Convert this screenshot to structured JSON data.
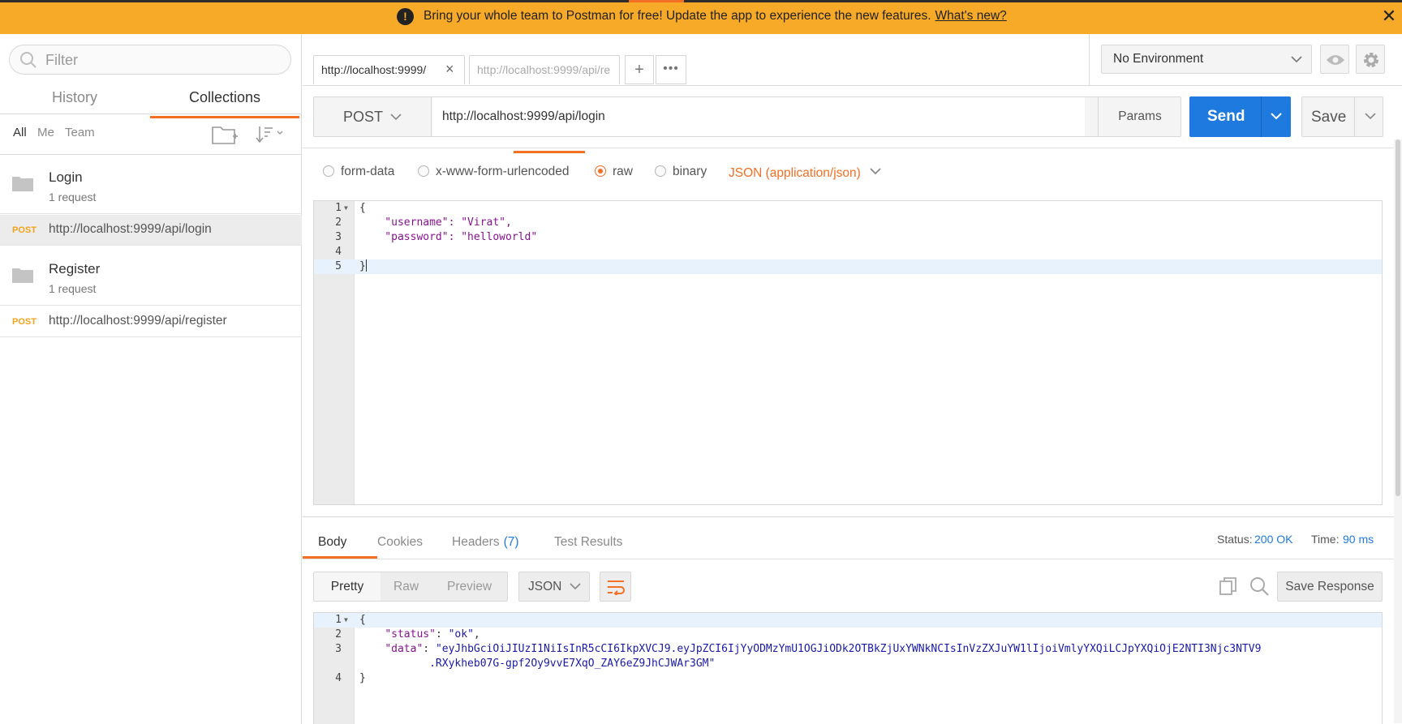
{
  "banner": {
    "message": "Bring your whole team to Postman for free! Update the app to experience the new features.",
    "link": "What's new?",
    "close": "✕",
    "icon": "!"
  },
  "sidebar": {
    "filter_placeholder": "Filter",
    "tabs": [
      "History",
      "Collections"
    ],
    "active_tab": "Collections",
    "filters": [
      "All",
      "Me",
      "Team"
    ],
    "collections": [
      {
        "name": "Login",
        "count": "1 request",
        "request": {
          "method": "POST",
          "url": "http://localhost:9999/api/login"
        }
      },
      {
        "name": "Register",
        "count": "1 request",
        "request": {
          "method": "POST",
          "url": "http://localhost:9999/api/register"
        }
      }
    ]
  },
  "tabs": {
    "items": [
      "http://localhost:9999/",
      "http://localhost:9999/api/re"
    ],
    "close": "×",
    "plus": "+",
    "more": "•••"
  },
  "environment": {
    "selected": "No Environment"
  },
  "request": {
    "method": "POST",
    "url": "http://localhost:9999/api/login",
    "params_label": "Params",
    "send_label": "Send",
    "save_label": "Save",
    "body_modes": [
      "form-data",
      "x-www-form-urlencoded",
      "raw",
      "binary"
    ],
    "selected_mode": "raw",
    "content_type": "JSON (application/json)",
    "body_lines": [
      "{",
      "    \"username\": \"Virat\",",
      "    \"password\": \"helloworld\"",
      "",
      "}"
    ],
    "line_numbers": [
      "1",
      "2",
      "3",
      "4",
      "5"
    ]
  },
  "response": {
    "tabs": [
      "Body",
      "Cookies",
      "Headers",
      "Test Results"
    ],
    "headers_count": "(7)",
    "status_label": "Status:",
    "status": "200 OK",
    "time_label": "Time:",
    "time": "90 ms",
    "view_modes": [
      "Pretty",
      "Raw",
      "Preview"
    ],
    "format": "JSON",
    "save_response_label": "Save Response",
    "line_numbers": [
      "1",
      "2",
      "3",
      "4"
    ],
    "body": {
      "l1": "{",
      "status_key": "\"status\"",
      "status_val": "\"ok\"",
      "data_key": "\"data\"",
      "data_val_1": "\"eyJhbGciOiJIUzI1NiIsInR5cCI6IkpXVCJ9.eyJpZCI6IjYyODMzYmU1OGJiODk2OTBkZjUxYWNkNCIsInVzZXJuYW1lIjoiVmlyYXQiLCJpYXQiOjE2NTI3Njc3NTV9",
      "data_val_2": ".RXykheb07G-gpf2Oy9vvE7XqO_ZAY6eZ9JhCJWAr3GM\"",
      "l4": "}"
    }
  }
}
